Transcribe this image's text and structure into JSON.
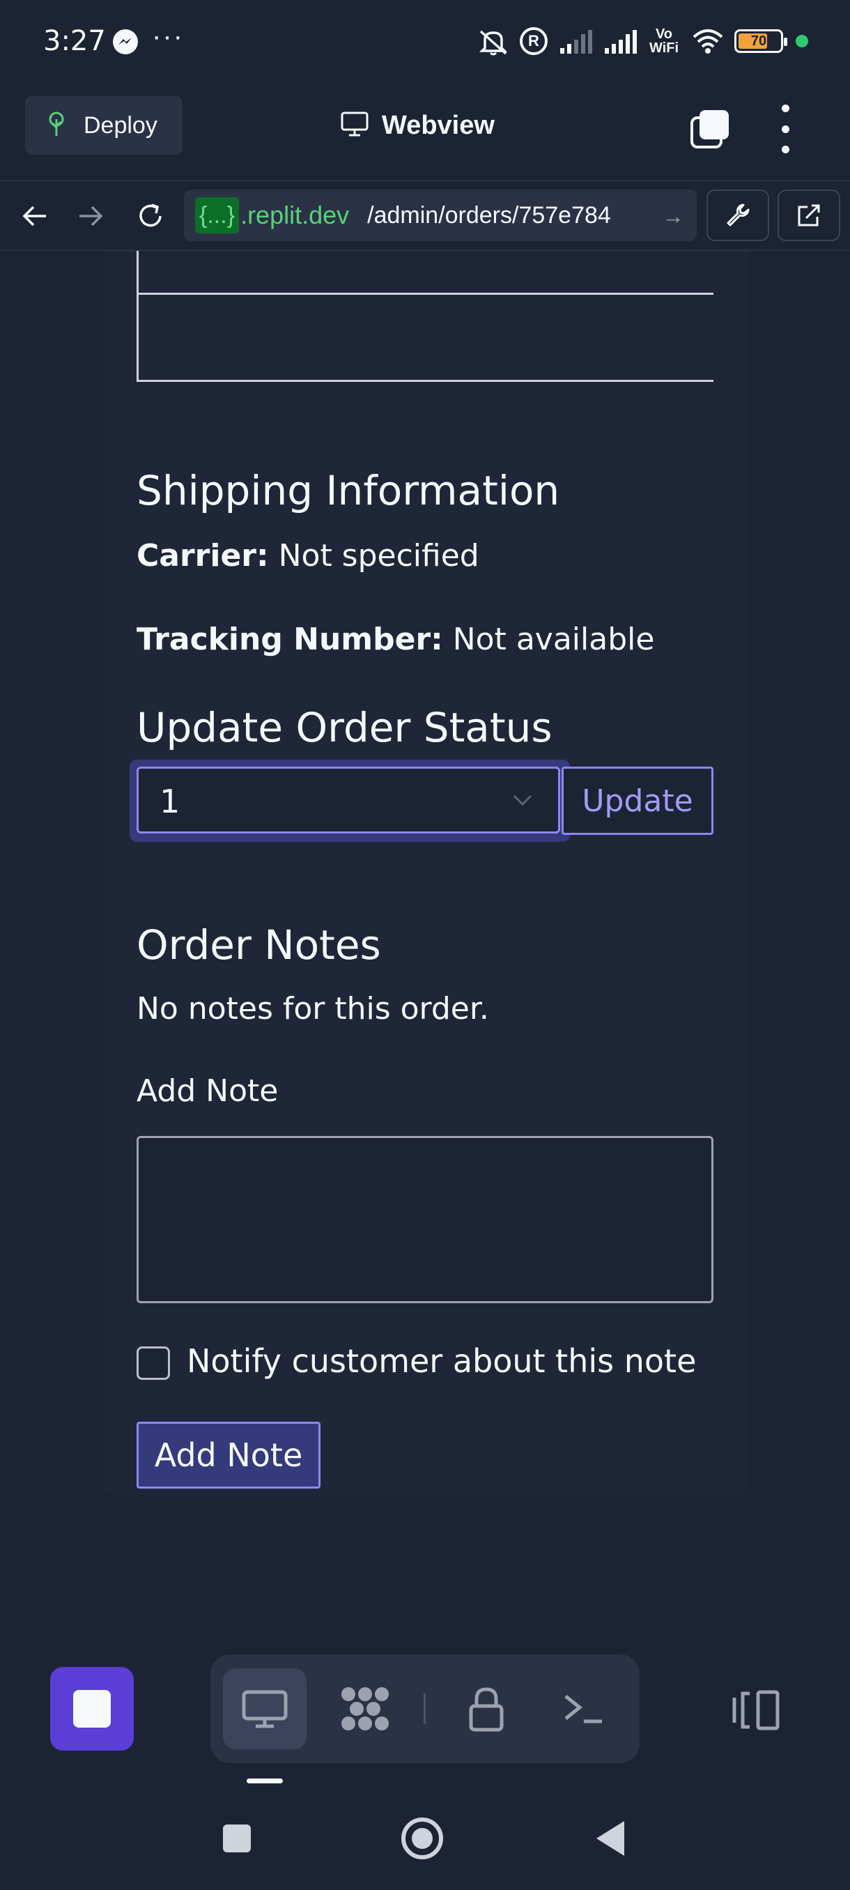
{
  "status_bar": {
    "time": "3:27",
    "dots": "···",
    "vowifi_line1": "Vo",
    "vowifi_line2": "WiFi",
    "battery_level": "70",
    "accent_dot_color": "#2ecc71"
  },
  "toolbar": {
    "deploy_label": "Deploy",
    "title": "Webview"
  },
  "url_bar": {
    "chip": "{...}",
    "domain": ".replit.dev",
    "path": "/admin/orders/757e784"
  },
  "shipping": {
    "heading": "Shipping Information",
    "carrier_label": "Carrier:",
    "carrier_value": "Not specified",
    "tracking_label": "Tracking Number:",
    "tracking_value": "Not available"
  },
  "status_update": {
    "heading": "Update Order Status",
    "selected_value": "1",
    "update_label": "Update"
  },
  "notes": {
    "heading": "Order Notes",
    "empty_text": "No notes for this order.",
    "add_note_label": "Add Note",
    "note_value": "",
    "notify_label": "Notify customer about this note",
    "notify_checked": false,
    "submit_label": "Add Note"
  },
  "colors": {
    "background": "#1c2333",
    "accent": "#8d87f0",
    "stop_button": "#5b3ed6",
    "domain_green": "#58d27a"
  },
  "bottom_bar": {
    "icons": [
      "stop-icon",
      "webview-pane-icon",
      "packager-icon",
      "secrets-lock-icon",
      "shell-icon",
      "layout-icon"
    ]
  }
}
